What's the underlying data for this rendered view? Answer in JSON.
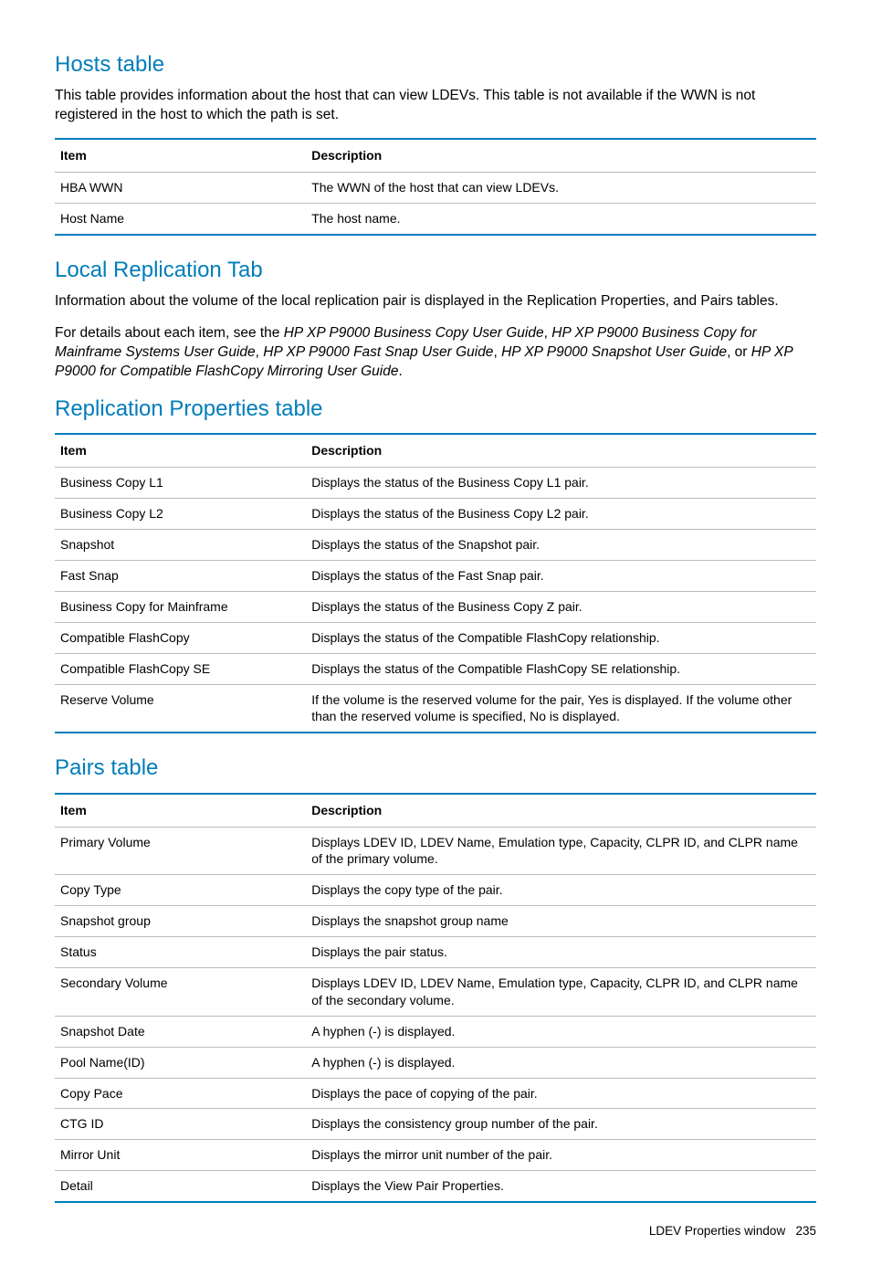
{
  "sections": [
    {
      "heading": "Hosts table",
      "paragraphs": [
        {
          "parts": [
            {
              "text": "This table provides information about the host that can view LDEVs. This table is not available if the WWN is not registered in the host to which the path is set."
            }
          ]
        }
      ],
      "table": {
        "headers": [
          "Item",
          "Description"
        ],
        "rows": [
          [
            "HBA WWN",
            "The WWN of the host that can view LDEVs."
          ],
          [
            "Host Name",
            "The host name."
          ]
        ]
      }
    },
    {
      "heading": "Local Replication Tab",
      "paragraphs": [
        {
          "parts": [
            {
              "text": "Information about the volume of the local replication pair is displayed in the Replication Properties, and Pairs tables."
            }
          ]
        },
        {
          "parts": [
            {
              "text": "For details about each item, see the "
            },
            {
              "text": "HP XP P9000 Business Copy User Guide",
              "italic": true
            },
            {
              "text": ", "
            },
            {
              "text": "HP XP P9000 Business Copy for Mainframe Systems User Guide",
              "italic": true
            },
            {
              "text": ", "
            },
            {
              "text": "HP XP P9000 Fast Snap User Guide",
              "italic": true
            },
            {
              "text": ", "
            },
            {
              "text": "HP XP P9000 Snapshot User Guide",
              "italic": true
            },
            {
              "text": ", or "
            },
            {
              "text": "HP XP P9000 for Compatible FlashCopy Mirroring User Guide",
              "italic": true
            },
            {
              "text": "."
            }
          ]
        }
      ]
    },
    {
      "heading": "Replication Properties table",
      "table": {
        "headers": [
          "Item",
          "Description"
        ],
        "rows": [
          [
            "Business Copy L1",
            "Displays the status of the Business Copy L1 pair."
          ],
          [
            "Business Copy L2",
            "Displays the status of the Business Copy L2 pair."
          ],
          [
            "Snapshot",
            "Displays the status of the Snapshot pair."
          ],
          [
            "Fast Snap",
            "Displays the status of the Fast Snap pair."
          ],
          [
            "Business Copy for Mainframe",
            "Displays the status of the Business Copy Z pair."
          ],
          [
            "Compatible FlashCopy",
            "Displays the status of the Compatible FlashCopy relationship."
          ],
          [
            "Compatible FlashCopy SE",
            "Displays the status of the Compatible FlashCopy SE relationship."
          ],
          [
            "Reserve Volume",
            "If the volume is the reserved volume for the pair, Yes is displayed. If the volume other than the reserved volume is specified, No is displayed."
          ]
        ]
      }
    },
    {
      "heading": "Pairs table",
      "table": {
        "headers": [
          "Item",
          "Description"
        ],
        "rows": [
          [
            "Primary Volume",
            "Displays LDEV ID, LDEV Name, Emulation type, Capacity, CLPR ID, and CLPR name of the primary volume."
          ],
          [
            "Copy Type",
            "Displays the copy type of the pair."
          ],
          [
            "Snapshot group",
            "Displays the snapshot group name"
          ],
          [
            "Status",
            "Displays the pair status."
          ],
          [
            "Secondary Volume",
            "Displays LDEV ID, LDEV Name, Emulation type, Capacity, CLPR ID, and CLPR name of the secondary volume."
          ],
          [
            "Snapshot Date",
            "A hyphen (-) is displayed."
          ],
          [
            "Pool Name(ID)",
            "A hyphen (-) is displayed."
          ],
          [
            "Copy Pace",
            "Displays the pace of copying of the pair."
          ],
          [
            "CTG ID",
            "Displays the consistency group number of the pair."
          ],
          [
            "Mirror Unit",
            "Displays the mirror unit number of the pair."
          ],
          [
            "Detail",
            "Displays the View Pair Properties."
          ]
        ]
      }
    }
  ],
  "footer": {
    "text": "LDEV Properties window",
    "page": "235"
  }
}
